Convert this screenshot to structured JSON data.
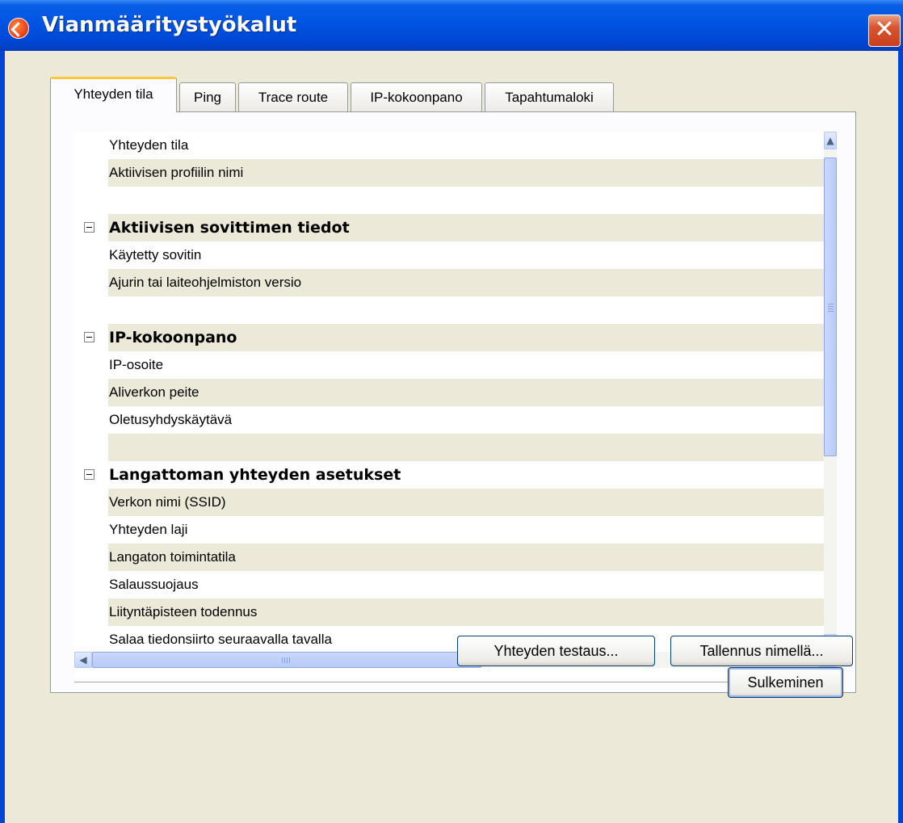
{
  "window": {
    "title": "Vianmääritystyökalut",
    "close_label": "✕"
  },
  "tabs": [
    {
      "label": "Yhteyden tila",
      "active": true
    },
    {
      "label": "Ping",
      "active": false
    },
    {
      "label": "Trace route",
      "active": false
    },
    {
      "label": "IP-kokoonpano",
      "active": false
    },
    {
      "label": "Tapahtumaloki",
      "active": false
    }
  ],
  "rows": [
    {
      "type": "item",
      "text": "Yhteyden tila",
      "shaded": false
    },
    {
      "type": "item",
      "text": "Aktiivisen profiilin nimi",
      "shaded": true
    },
    {
      "type": "blank",
      "text": "",
      "shaded": false
    },
    {
      "type": "group",
      "text": "Aktiivisen sovittimen tiedot",
      "shaded": true
    },
    {
      "type": "item",
      "text": "Käytetty sovitin",
      "shaded": false
    },
    {
      "type": "item",
      "text": "Ajurin tai laiteohjelmiston versio",
      "shaded": true
    },
    {
      "type": "blank",
      "text": "",
      "shaded": false
    },
    {
      "type": "group",
      "text": "IP-kokoonpano",
      "shaded": true
    },
    {
      "type": "item",
      "text": "IP-osoite",
      "shaded": false
    },
    {
      "type": "item",
      "text": "Aliverkon peite",
      "shaded": true
    },
    {
      "type": "item",
      "text": "Oletusyhdyskäytävä",
      "shaded": false
    },
    {
      "type": "blank",
      "text": "",
      "shaded": true
    },
    {
      "type": "group",
      "text": "Langattoman yhteyden asetukset",
      "shaded": false
    },
    {
      "type": "item",
      "text": "Verkon nimi (SSID)",
      "shaded": true
    },
    {
      "type": "item",
      "text": "Yhteyden laji",
      "shaded": false
    },
    {
      "type": "item",
      "text": "Langaton toimintatila",
      "shaded": true
    },
    {
      "type": "item",
      "text": "Salaussuojaus",
      "shaded": false
    },
    {
      "type": "item",
      "text": "Liityntäpisteen todennus",
      "shaded": true
    },
    {
      "type": "item",
      "text": "Salaa tiedonsiirto seuraavalla tavalla",
      "shaded": false
    }
  ],
  "buttons": {
    "test_connection": "Yhteyden testaus...",
    "save_as": "Tallennus nimellä...",
    "close": "Sulkeminen"
  },
  "icons": {
    "scroll_up": "▲",
    "scroll_down": "▼",
    "scroll_left": "◀",
    "scroll_right": "▶"
  }
}
